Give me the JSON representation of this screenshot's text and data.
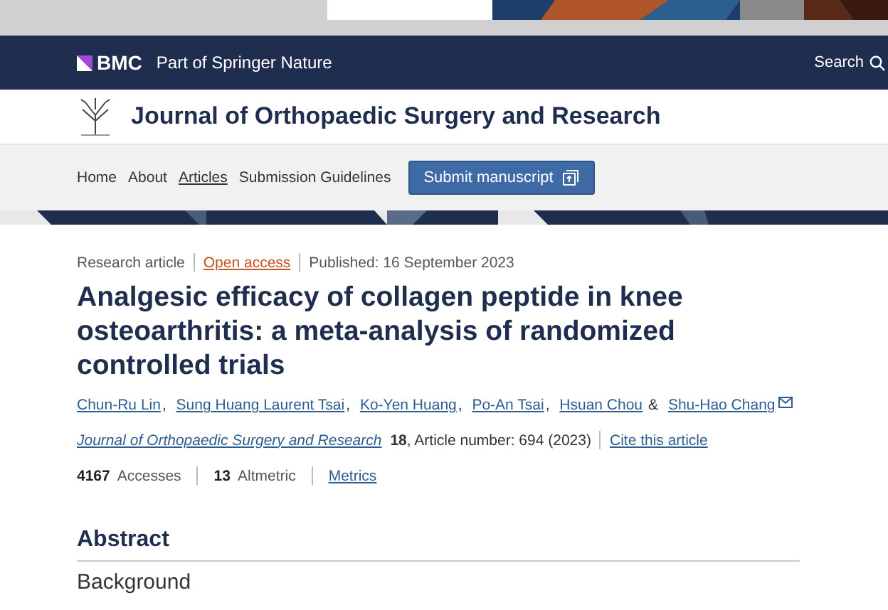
{
  "brand_bar": {
    "logo": "BMC",
    "tagline": "Part of Springer Nature",
    "search": "Search"
  },
  "journal": {
    "title": "Journal of Orthopaedic Surgery and Research"
  },
  "nav": {
    "items": [
      {
        "label": "Home",
        "selected": false
      },
      {
        "label": "About",
        "selected": false
      },
      {
        "label": "Articles",
        "selected": true
      },
      {
        "label": "Submission Guidelines",
        "selected": false
      }
    ],
    "button": "Submit manuscript"
  },
  "article": {
    "type": "Research article",
    "access": "Open access",
    "published": "Published: 16 September 2023",
    "title": "Analgesic efficacy of collagen peptide in knee osteoarthritis: a meta-analysis of randomized controlled trials",
    "authors": [
      {
        "name": "Chun-Ru Lin",
        "after": ",",
        "corresponding": false
      },
      {
        "name": "Sung Huang Laurent Tsai",
        "after": ",",
        "corresponding": false
      },
      {
        "name": "Ko-Yen Huang",
        "after": ",",
        "corresponding": false
      },
      {
        "name": "Po-An Tsai",
        "after": ",",
        "corresponding": false
      },
      {
        "name": "Hsuan Chou",
        "after": "&",
        "corresponding": false
      },
      {
        "name": "Shu-Hao Chang",
        "corresponding": true
      }
    ],
    "citation": {
      "journal": "Journal of Orthopaedic Surgery and Research",
      "volume": "18",
      "details": ", Article number: 694 (2023)",
      "cite_link": "Cite this article"
    },
    "metrics": [
      {
        "value": "4167",
        "label": "Accesses"
      },
      {
        "value": "13",
        "label": "Altmetric"
      }
    ],
    "metrics_link": "Metrics"
  },
  "abstract": {
    "heading": "Abstract",
    "subheading": "Background"
  }
}
